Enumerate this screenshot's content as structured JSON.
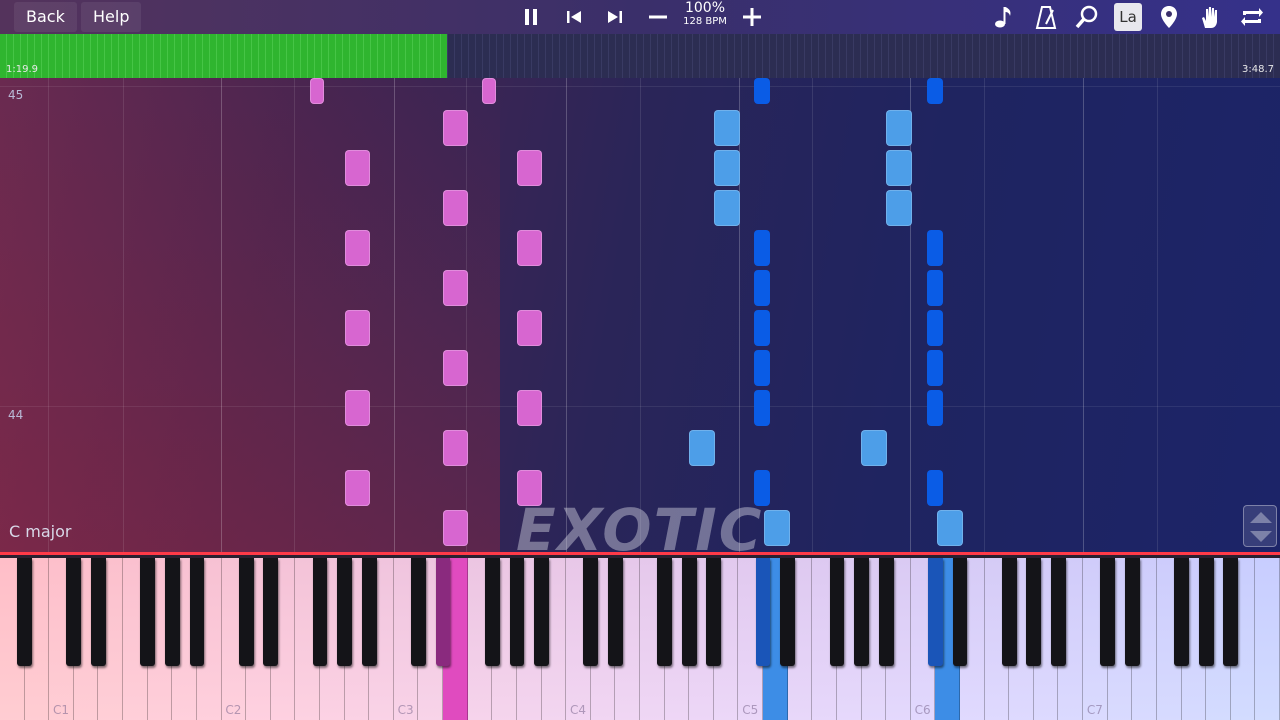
{
  "toolbar": {
    "back_label": "Back",
    "help_label": "Help",
    "tempo_percent": "100%",
    "tempo_bpm": "128 BPM",
    "icons": [
      "pause-icon",
      "skip-back-icon",
      "skip-forward-icon",
      "minus-icon",
      "plus-icon",
      "note-icon",
      "metronome-icon",
      "magnifier-icon",
      "note-names-icon",
      "location-pin-icon",
      "hand-icon",
      "loop-icon"
    ],
    "note_names_label": "La"
  },
  "timeline": {
    "current_time": "1:19.9",
    "total_time": "3:48.7",
    "progress": 0.349
  },
  "roll": {
    "measures": [
      {
        "label": "45"
      },
      {
        "label": "44"
      }
    ],
    "key_signature": "C major",
    "watermark": "EXOTIC"
  },
  "keyboard": {
    "octave_labels": [
      "C1",
      "C2",
      "C3",
      "C4",
      "C5",
      "C6",
      "C7"
    ],
    "active_colors": {
      "left_hand": "#e04bbf",
      "right_hand": "#3d8de6"
    }
  },
  "colors": {
    "accent_red": "#ff3a48",
    "progress_green": "#2fb52f",
    "note_pink": "#d766d0",
    "note_blue": "#0a5ce6",
    "note_lightblue": "#4d9ee8"
  }
}
